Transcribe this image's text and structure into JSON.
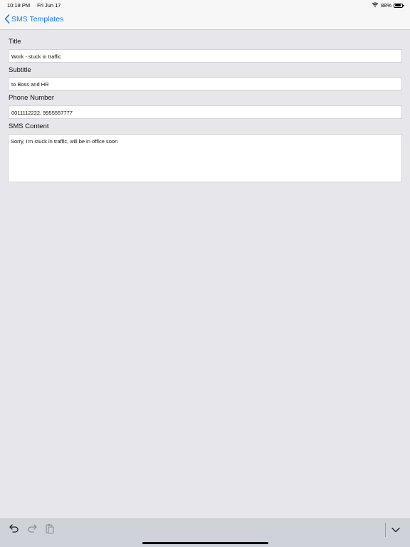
{
  "status_bar": {
    "time": "10:18 PM",
    "date": "Fri Jun 17",
    "battery_percent": "88%",
    "battery_level": 0.88,
    "wifi_icon": "wifi-icon"
  },
  "nav": {
    "back_label": "SMS Templates"
  },
  "form": {
    "title_label": "Title",
    "title_value": "Work - stuck in traffic",
    "subtitle_label": "Subtitle",
    "subtitle_value": "to Boss and HR",
    "phone_label": "Phone Number",
    "phone_value": "0011112222, 9955557777",
    "content_label": "SMS Content",
    "content_value": "Sorry, I'm stuck in traffic, will be in office soon"
  },
  "toolbar": {
    "icons": [
      "undo-icon",
      "redo-icon",
      "paste-icon",
      "keyboard-dismiss-icon"
    ]
  }
}
